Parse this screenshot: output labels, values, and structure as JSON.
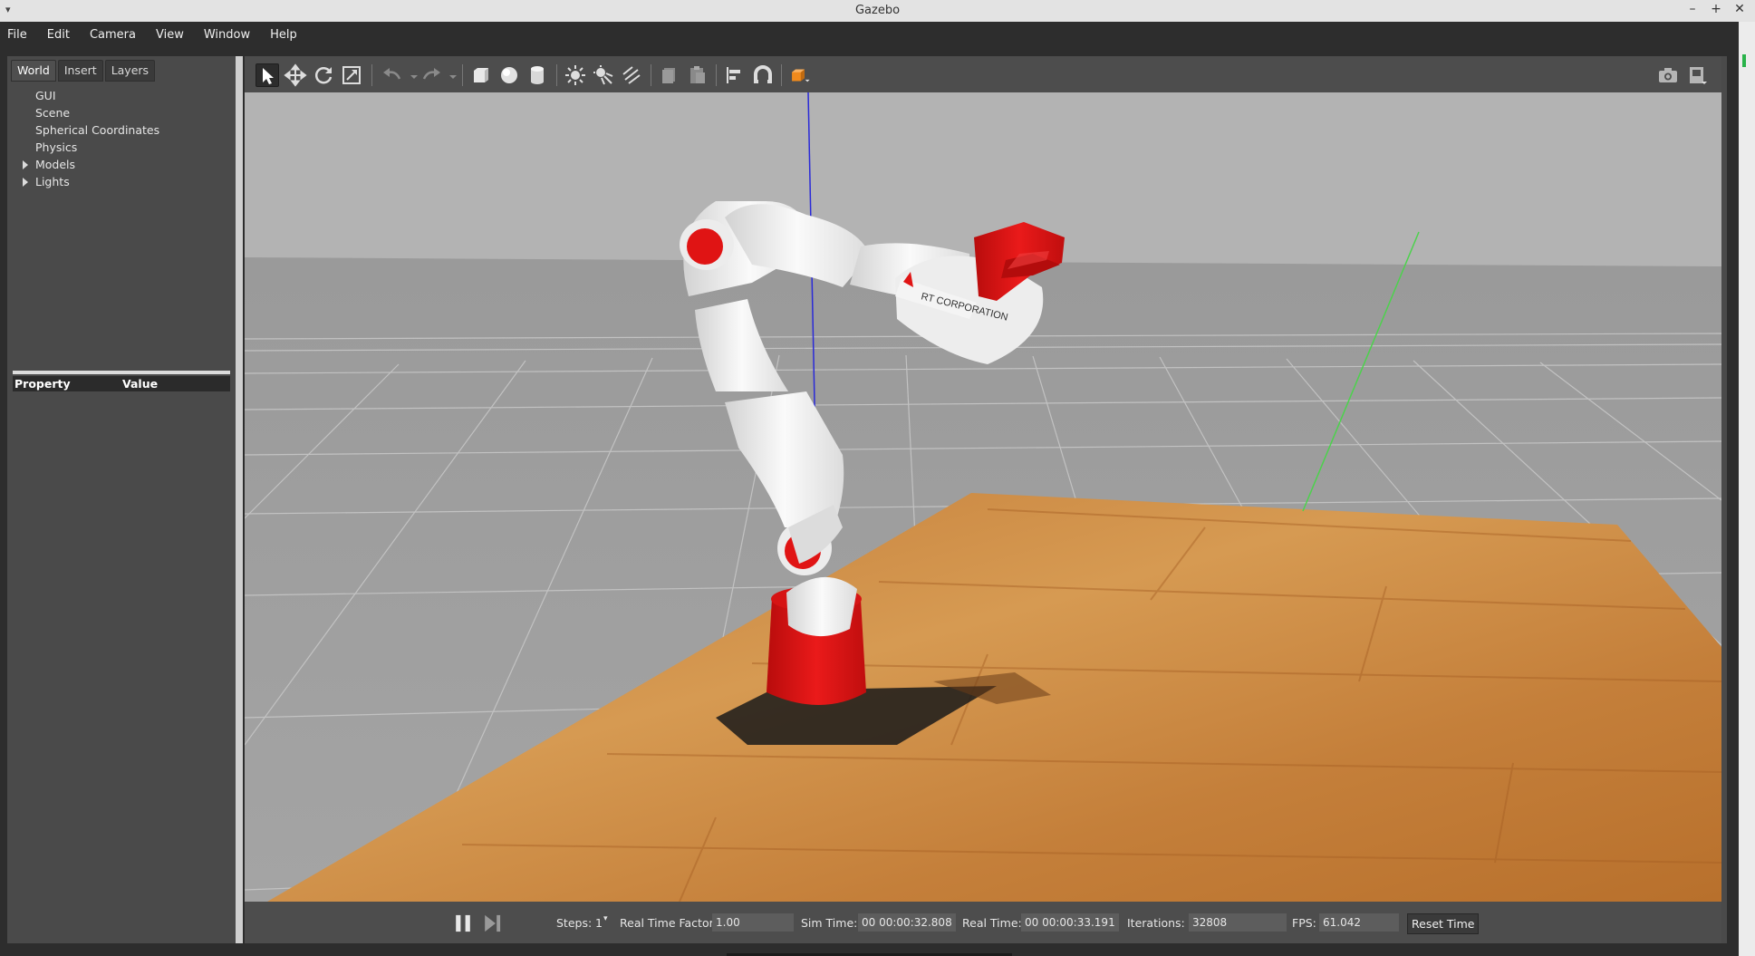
{
  "window": {
    "title": "Gazebo",
    "sys_menu_glyph": "▾",
    "minimize": "–",
    "maximize": "+",
    "close": "✕"
  },
  "menubar": [
    {
      "label": "File"
    },
    {
      "label": "Edit"
    },
    {
      "label": "Camera"
    },
    {
      "label": "View"
    },
    {
      "label": "Window"
    },
    {
      "label": "Help"
    }
  ],
  "tabs": [
    {
      "label": "World",
      "active": true
    },
    {
      "label": "Insert",
      "active": false
    },
    {
      "label": "Layers",
      "active": false
    }
  ],
  "tree": [
    {
      "label": "GUI",
      "expandable": false
    },
    {
      "label": "Scene",
      "expandable": false
    },
    {
      "label": "Spherical Coordinates",
      "expandable": false
    },
    {
      "label": "Physics",
      "expandable": false
    },
    {
      "label": "Models",
      "expandable": true
    },
    {
      "label": "Lights",
      "expandable": true
    }
  ],
  "properties": {
    "col_property": "Property",
    "col_value": "Value"
  },
  "toolbar": {
    "tools": [
      "select-arrow-icon",
      "translate-icon",
      "rotate-icon",
      "scale-icon",
      "undo-icon",
      "redo-icon",
      "box-icon",
      "sphere-icon",
      "cylinder-icon",
      "point-light-icon",
      "spot-light-icon",
      "directional-light-icon",
      "copy-icon",
      "paste-icon",
      "align-icon",
      "snap-icon",
      "view-angle-icon",
      "screenshot-icon",
      "record-icon"
    ],
    "active_tool": "select-arrow-icon"
  },
  "scene": {
    "robot_label": "RT CORPORATION",
    "colors": {
      "sky": "#b2b2b2",
      "ground": "#9b9b9b",
      "grid": "#bdbdbd",
      "table": "#c98540",
      "robot_red": "#e01414",
      "robot_white": "#f2f2f2",
      "z_axis": "#2a2ad8",
      "y_axis": "#4cd24c"
    }
  },
  "bottombar": {
    "steps_label": "Steps:",
    "steps_value": "1",
    "rtf_label": "Real Time Factor:",
    "rtf_value": "1.00",
    "sim_time_label": "Sim Time:",
    "sim_time_value": "00 00:00:32.808",
    "real_time_label": "Real Time:",
    "real_time_value": "00 00:00:33.191",
    "iterations_label": "Iterations:",
    "iterations_value": "32808",
    "fps_label": "FPS:",
    "fps_value": "61.042",
    "reset_label": "Reset Time"
  }
}
